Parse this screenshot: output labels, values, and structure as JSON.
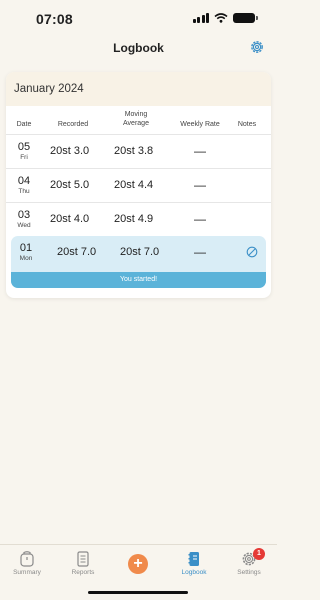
{
  "status": {
    "time": "07:08"
  },
  "nav": {
    "title": "Logbook",
    "settings_icon": "gear-icon"
  },
  "colors": {
    "accent": "#3b8fc7",
    "highlight_row": "#d9edf6",
    "banner": "#5bb3d9",
    "add": "#f08a4b",
    "badge": "#e53935"
  },
  "logbook": {
    "month": "January 2024",
    "columns": {
      "date": "Date",
      "recorded": "Recorded",
      "avg_line1": "Moving",
      "avg_line2": "Average",
      "rate": "Weekly Rate",
      "notes": "Notes"
    },
    "rows": [
      {
        "day": "05",
        "dow": "Fri",
        "recorded": "20st 3.0",
        "average": "20st 3.8",
        "rate": "—"
      },
      {
        "day": "04",
        "dow": "Thu",
        "recorded": "20st 5.0",
        "average": "20st 4.4",
        "rate": "—"
      },
      {
        "day": "03",
        "dow": "Wed",
        "recorded": "20st 4.0",
        "average": "20st 4.9",
        "rate": "—"
      },
      {
        "day": "01",
        "dow": "Mon",
        "recorded": "20st 7.0",
        "average": "20st 7.0",
        "rate": "—",
        "note_icon": "no-entry-icon",
        "banner": "You started!"
      }
    ]
  },
  "tabs": {
    "summary": "Summary",
    "reports": "Reports",
    "add": "+",
    "logbook": "Logbook",
    "settings": "Settings",
    "settings_badge": "1"
  }
}
